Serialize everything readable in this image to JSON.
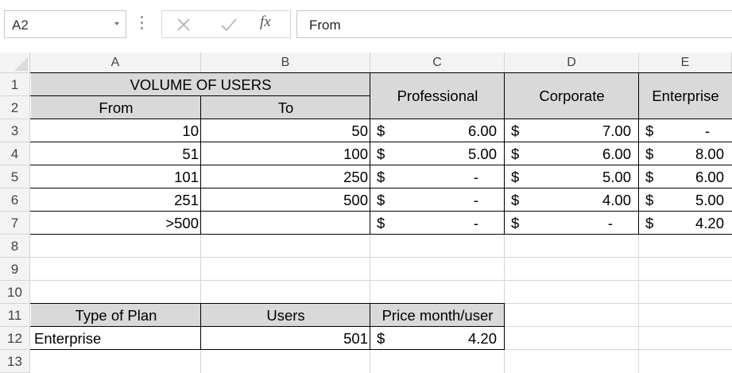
{
  "formula_bar": {
    "name_box": "A2",
    "name_box_icon": "chevron-down-icon",
    "cancel_icon": "close-icon",
    "enter_icon": "check-icon",
    "fx_label": "fx",
    "formula_value": "From"
  },
  "columns": [
    "A",
    "B",
    "C",
    "D",
    "E"
  ],
  "rows": [
    "1",
    "2",
    "3",
    "4",
    "5",
    "6",
    "7",
    "8",
    "9",
    "10",
    "11",
    "12",
    "13"
  ],
  "colors": {
    "header_fill": "#d9d9d9",
    "gridline": "#d4d4d4",
    "border": "#000000"
  },
  "pricing_table": {
    "group_header": "VOLUME OF USERS",
    "from_header": "From",
    "to_header": "To",
    "plans": [
      "Professional",
      "Corporate",
      "Enterprise"
    ],
    "currency": "$",
    "tiers": [
      {
        "from": "10",
        "to": "50",
        "professional": "6.00",
        "corporate": "7.00",
        "enterprise": "-"
      },
      {
        "from": "51",
        "to": "100",
        "professional": "5.00",
        "corporate": "6.00",
        "enterprise": "8.00"
      },
      {
        "from": "101",
        "to": "250",
        "professional": "-",
        "corporate": "5.00",
        "enterprise": "6.00"
      },
      {
        "from": "251",
        "to": "500",
        "professional": "-",
        "corporate": "4.00",
        "enterprise": "5.00"
      },
      {
        "from": ">500",
        "to": "",
        "professional": "-",
        "corporate": "-",
        "enterprise": "4.20"
      }
    ]
  },
  "lookup": {
    "type_header": "Type of Plan",
    "users_header": "Users",
    "price_header": "Price month/user",
    "type_value": "Enterprise",
    "users_value": "501",
    "currency": "$",
    "price_value": "4.20"
  }
}
